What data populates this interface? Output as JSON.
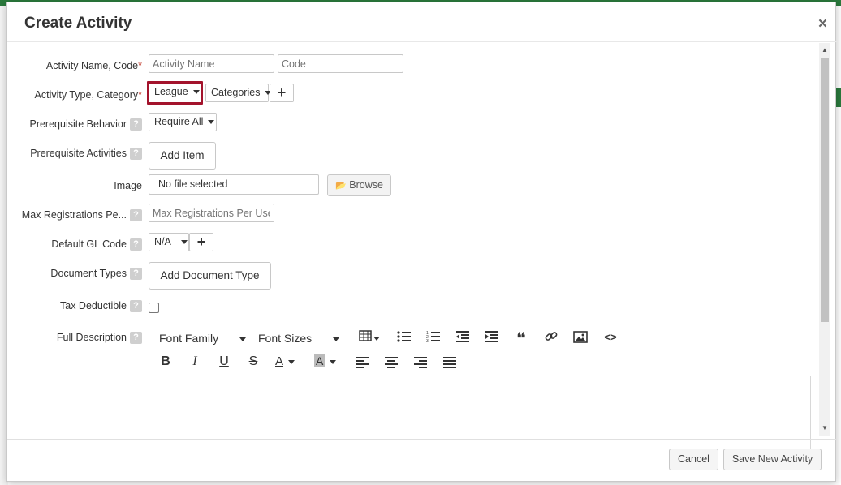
{
  "modal": {
    "title": "Create Activity",
    "close": "×"
  },
  "fields": {
    "activity_name_code": {
      "label": "Activity Name, Code",
      "required_mark": "*",
      "name_placeholder": "Activity Name",
      "code_placeholder": "Code"
    },
    "activity_type_category": {
      "label": "Activity Type, Category",
      "required_mark": "*",
      "type_value": "League",
      "category_value": "Categories"
    },
    "prerequisite_behavior": {
      "label": "Prerequisite Behavior",
      "value": "Require All"
    },
    "prerequisite_activities": {
      "label": "Prerequisite Activities",
      "button": "Add Item"
    },
    "image": {
      "label": "Image",
      "file_text": "No file selected",
      "browse_button": "Browse"
    },
    "max_registrations": {
      "label": "Max Registrations Pe...",
      "placeholder": "Max Registrations Per User"
    },
    "default_gl_code": {
      "label": "Default GL Code",
      "value": "N/A"
    },
    "document_types": {
      "label": "Document Types",
      "button": "Add Document Type"
    },
    "tax_deductible": {
      "label": "Tax Deductible",
      "checked": false
    },
    "full_description": {
      "label": "Full Description"
    }
  },
  "help_icon_text": "?",
  "editor_toolbar": {
    "font_family": "Font Family",
    "font_sizes": "Font Sizes",
    "row1_icons": [
      "table-icon",
      "bullet-list-icon",
      "numbered-list-icon",
      "outdent-icon",
      "indent-icon",
      "blockquote-icon",
      "link-icon",
      "image-icon",
      "code-icon"
    ],
    "row2_icons": [
      "bold-icon",
      "italic-icon",
      "underline-icon",
      "strikethrough-icon",
      "text-color-icon",
      "background-color-icon",
      "align-left-icon",
      "align-center-icon",
      "align-right-icon",
      "justify-icon"
    ],
    "glyphs": {
      "bold": "B",
      "italic": "I",
      "underline": "U",
      "strike": "S",
      "text_color": "A",
      "bg_color": "A",
      "quote": "❝",
      "code": "<>"
    }
  },
  "footer": {
    "cancel": "Cancel",
    "save": "Save New Activity"
  },
  "colors": {
    "highlight": "#a3132c",
    "brand_green": "#2b7a3d"
  }
}
